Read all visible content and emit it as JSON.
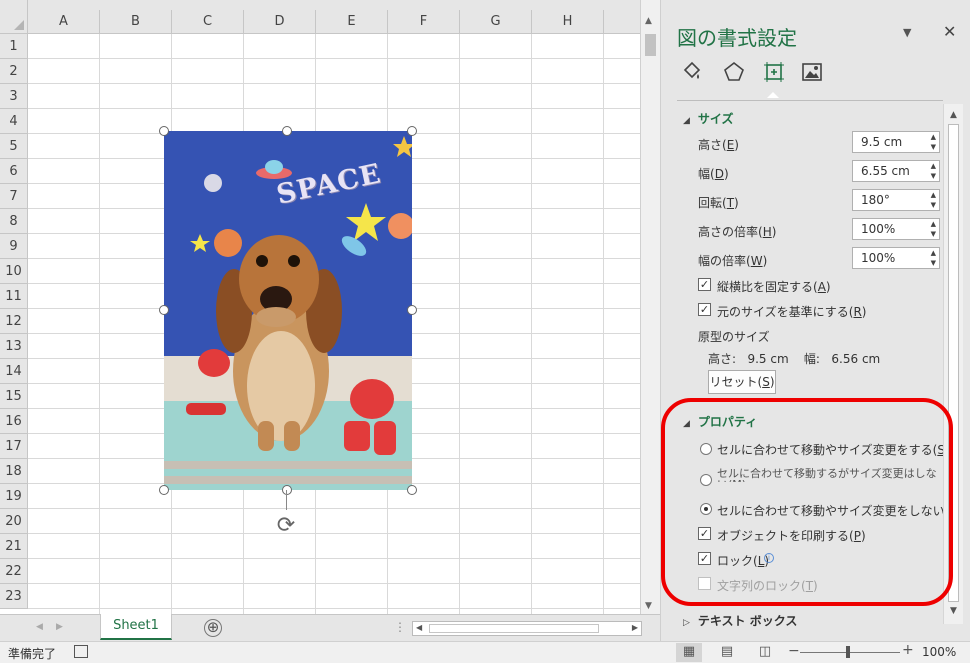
{
  "columns": [
    "A",
    "B",
    "C",
    "D",
    "E",
    "F",
    "G",
    "H"
  ],
  "rows": [
    "1",
    "2",
    "3",
    "4",
    "5",
    "6",
    "7",
    "8",
    "9",
    "10",
    "11",
    "12",
    "13",
    "14",
    "15",
    "16",
    "17",
    "18",
    "19",
    "20",
    "21",
    "22",
    "23"
  ],
  "picture": {
    "text": "SPACE"
  },
  "sheet_tabs": {
    "active": "Sheet1",
    "add": "⊕"
  },
  "status": {
    "ready": "準備完了",
    "zoom": "100%",
    "zoom_minus": "−",
    "zoom_plus": "+"
  },
  "pane": {
    "title": "図の書式設定",
    "dropdown": "▼",
    "close": "✕",
    "categories": [
      "fill-line-icon",
      "effects-icon",
      "size-properties-icon",
      "picture-icon"
    ],
    "size_section": {
      "label": "サイズ",
      "height": {
        "label": "高さ(E)",
        "value": "9.5 cm"
      },
      "width": {
        "label": "幅(D)",
        "value": "6.55 cm"
      },
      "rotation": {
        "label": "回転(T)",
        "value": "180°"
      },
      "scale_height": {
        "label": "高さの倍率(H)",
        "value": "100%"
      },
      "scale_width": {
        "label": "幅の倍率(W)",
        "value": "100%"
      },
      "lock_aspect": {
        "label": "縦横比を固定する(A)",
        "checked": true
      },
      "relative_original": {
        "label": "元のサイズを基準にする(R)",
        "checked": true
      },
      "original_size_heading": "原型のサイズ",
      "original_size_value": "高さ:   9.5 cm    幅:   6.56 cm",
      "reset": "リセット(S)"
    },
    "properties_section": {
      "label": "プロパティ",
      "radio1": "セルに合わせて移動やサイズ変更をする(S)",
      "radio2": "セルに合わせて移動するがサイズ変更はしない(M)",
      "radio3": "セルに合わせて移動やサイズ変更をしない(D)",
      "print_object": "オブジェクトを印刷する(P)",
      "lock": "ロック(L)",
      "lock_text": "文字列のロック(T)"
    },
    "textbox_section": {
      "label": "テキスト ボックス"
    }
  },
  "colors": {
    "accent": "#217346",
    "highlight": "#ee0000"
  }
}
